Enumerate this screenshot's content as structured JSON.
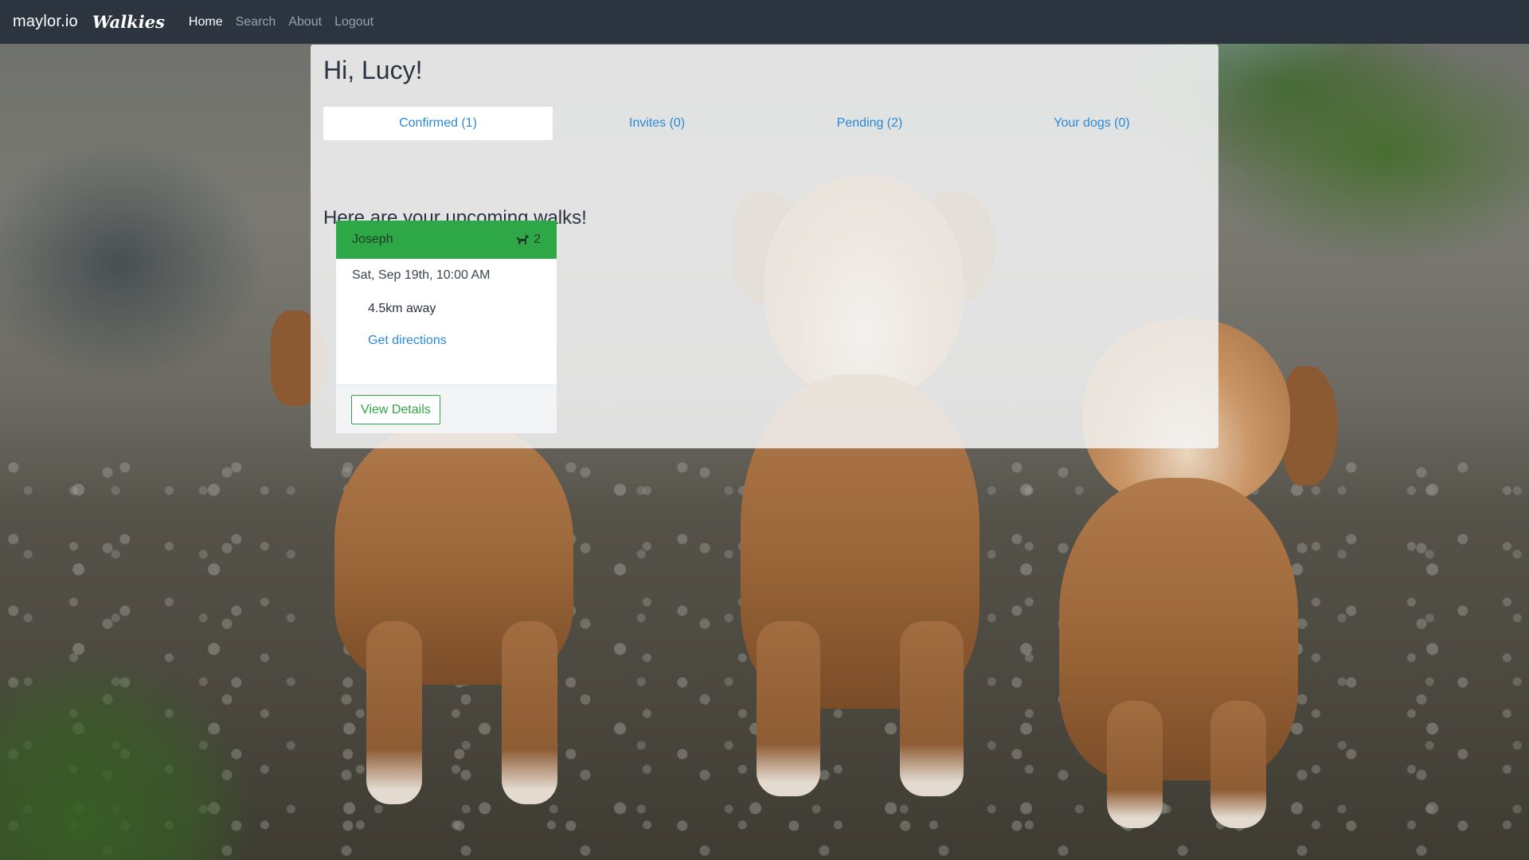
{
  "navbar": {
    "brand": "maylor.io",
    "app_name": "Walkies",
    "links": [
      {
        "label": "Home",
        "active": true
      },
      {
        "label": "Search",
        "active": false
      },
      {
        "label": "About",
        "active": false
      },
      {
        "label": "Logout",
        "active": false
      }
    ]
  },
  "main": {
    "greeting": "Hi, Lucy!",
    "tabs": [
      {
        "label": "Confirmed (1)",
        "active": true
      },
      {
        "label": "Invites (0)",
        "active": false
      },
      {
        "label": "Pending (2)",
        "active": false
      },
      {
        "label": "Your dogs (0)",
        "active": false
      }
    ],
    "subheading": "Here are your upcoming walks!",
    "walks": [
      {
        "owner": "Joseph",
        "dog_count": "2",
        "date": "Sat, Sep 19th, 10:00 AM",
        "distance": "4.5km away",
        "directions_label": "Get directions",
        "details_label": "View Details"
      }
    ]
  },
  "colors": {
    "navbar": "#2c3440",
    "accent_green": "#2ea846",
    "link_blue": "#2a8ad6"
  },
  "icons": {
    "dog_count": "dog-icon"
  }
}
